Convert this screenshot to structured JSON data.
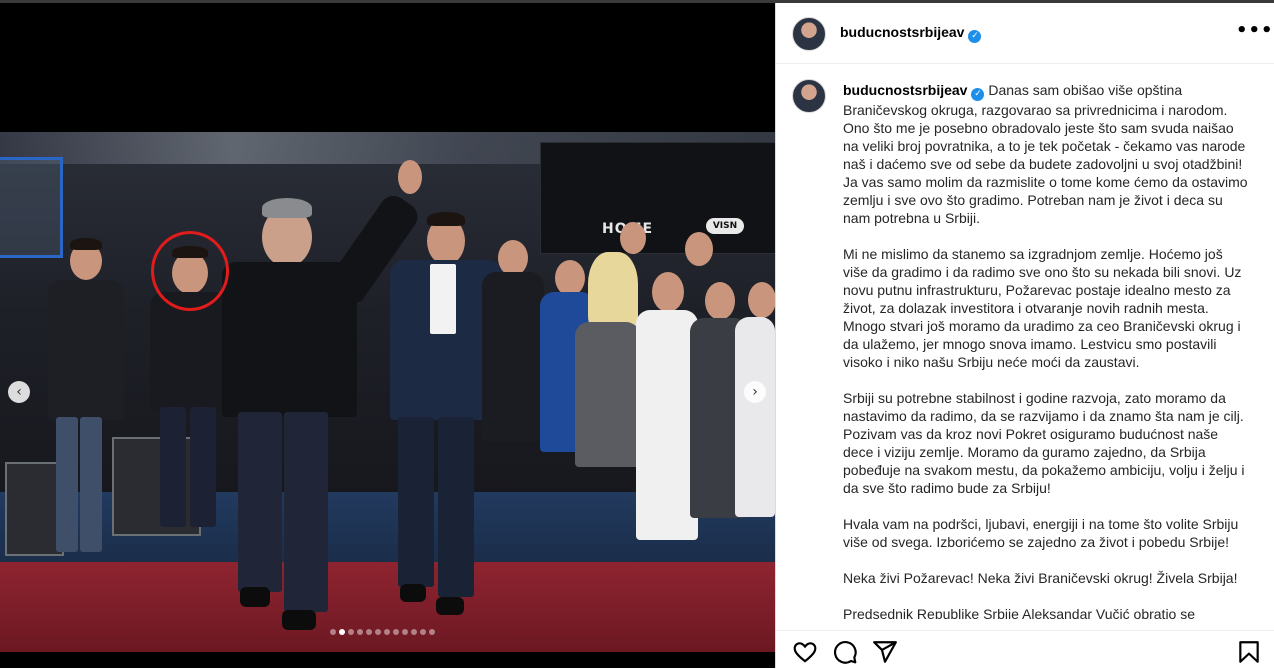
{
  "post": {
    "username": "buducnostsrbijeav",
    "verified_mark": "✓",
    "more_label": "•••",
    "carousel": {
      "prev_label": "‹",
      "next_label": "›",
      "slide_count": 12,
      "active_index": 1
    },
    "photo_text": {
      "banner": "HOME",
      "logo": "VISN"
    },
    "caption_paragraphs": [
      "Danas sam obišao više opština Braničevskog okruga, razgovarao sa privrednicima i narodom. Ono što me je posebno obradovalo jeste što sam svuda naišao na veliki broj povratnika, a to je tek početak - čekamo vas narode naš i daćemo sve od sebe da budete zadovoljni u svoj otadžbini! Ja vas samo molim da razmislite o tome kome ćemo da ostavimo zemlju i sve ovo što gradimo. Potreban nam je život i deca su nam potrebna u Srbiji.",
      "Mi ne mislimo da stanemo sa izgradnjom zemlje. Hoćemo još više da gradimo i da radimo sve ono što su nekada bili snovi. Uz novu putnu infrastrukturu, Požarevac postaje idealno mesto za život, za dolazak investitora i otvaranje novih radnih mesta. Mnogo stvari još moramo da uradimo za ceo Braničevski okrug i da ulažemo, jer mnogo snova imamo. Lestvicu smo postavili visoko i niko našu Srbiju neće moći da zaustavi.",
      "Srbiji su potrebne stabilnost i godine razvoja, zato moramo da nastavimo da radimo, da se razvijamo i da znamo šta nam je cilj. Pozivam vas da kroz novi Pokret osiguramo budućnost naše dece i viziju zemlje. Moramo da guramo zajedno, da Srbija pobeđuje na svakom mestu, da pokažemo ambiciju, volju i želju i da sve što radimo bude za Srbiju!",
      "Hvala vam na podršci, ljubavi, energiji i na tome što volite Srbiju više od svega. Izborićemo se zajedno za život i pobedu Srbije!",
      "Neka živi Požarevac! Neka živi Braničevski okrug! Živela Srbija!",
      "Predsednik Republike Srbije Aleksandar Vučić obratio se"
    ]
  },
  "colors": {
    "verified": "#1d8fe8",
    "highlight_circle": "#e21b1b"
  },
  "icons": [
    "heart-icon",
    "comment-icon",
    "share-icon",
    "bookmark-icon"
  ]
}
